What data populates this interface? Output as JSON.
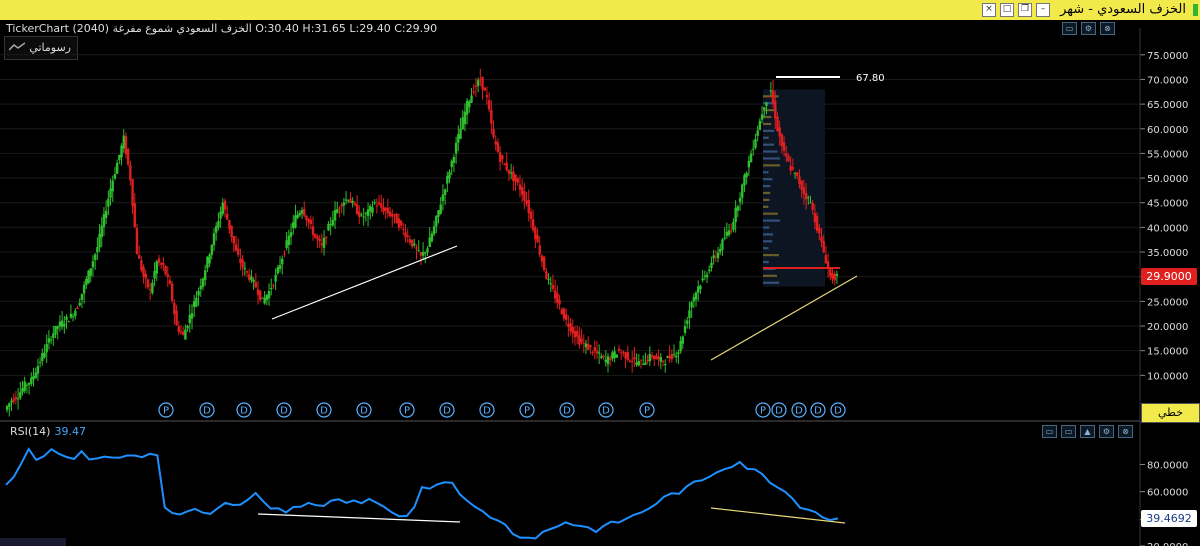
{
  "window": {
    "title": "الخزف السعودي - شهر",
    "controls": [
      "close",
      "maximize",
      "restore",
      "minimize"
    ]
  },
  "main_panel": {
    "info": "TickerChart الخزف السعودي شموع مفرغة (2040) O:30.40  H:31.65  L:29.40  C:29.90",
    "drawings_button": "رسوماتي",
    "price_ticks": [
      "75.0000",
      "70.0000",
      "65.0000",
      "60.0000",
      "55.0000",
      "50.0000",
      "45.0000",
      "40.0000",
      "35.0000",
      "30.0000",
      "25.0000",
      "20.0000",
      "15.0000",
      "10.0000"
    ],
    "last_price": "29.9000",
    "high_label": "67.80",
    "scale_mode_button": "خطي",
    "markers": [
      "P",
      "D",
      "D",
      "D",
      "D",
      "D",
      "P",
      "D",
      "D",
      "P",
      "D",
      "D",
      "P",
      "P",
      "D",
      "D",
      "D",
      "D"
    ]
  },
  "rsi_panel": {
    "label": "RSI(14)",
    "value": "39.47",
    "ticks": [
      "80.0000",
      "60.0000",
      "39.4692",
      "20.0000"
    ],
    "badge": "39.4692"
  },
  "colors": {
    "up": "#2fbf2f",
    "down": "#e01f1f",
    "rsi_line": "#1e90ff",
    "titlebar": "#f2e94a",
    "grid": "#1a1a1a"
  },
  "chart_data": {
    "type": "candlestick",
    "title": "الخزف السعودي",
    "interval": "monthly",
    "ohlc_last": {
      "open": 30.4,
      "high": 31.65,
      "low": 29.4,
      "close": 29.9
    },
    "ylim": [
      5,
      78
    ],
    "close_path": [
      3,
      5,
      6,
      8,
      9,
      12,
      15,
      18,
      20,
      21,
      22,
      24,
      28,
      32,
      36,
      42,
      48,
      53,
      58,
      50,
      35,
      30,
      27,
      33,
      32,
      28,
      20,
      18,
      22,
      26,
      30,
      35,
      40,
      45,
      40,
      35,
      32,
      30,
      28,
      25,
      27,
      30,
      34,
      38,
      42,
      44,
      41,
      38,
      36,
      40,
      43,
      45,
      46,
      44,
      42,
      43,
      45,
      44,
      43,
      42,
      40,
      38,
      36,
      34,
      36,
      40,
      45,
      50,
      55,
      60,
      65,
      68,
      70,
      66,
      58,
      54,
      52,
      50,
      48,
      45,
      40,
      35,
      30,
      27,
      24,
      21,
      19,
      17,
      16,
      15,
      14,
      13,
      14,
      15,
      14,
      13,
      12.5,
      13,
      14,
      13,
      13,
      14,
      15,
      20,
      25,
      28,
      30,
      33,
      35,
      38,
      40,
      45,
      50,
      55,
      60,
      65,
      67.8,
      60,
      55,
      52,
      50,
      47,
      45,
      40,
      35,
      30,
      29.9
    ],
    "annotations": [
      {
        "type": "horizontal",
        "value": 67.8,
        "label": "67.80"
      }
    ],
    "rsi": {
      "period": 14,
      "last": 39.47,
      "ylim": [
        20,
        98
      ],
      "values": [
        65,
        70,
        80,
        90,
        85,
        88,
        92,
        87,
        86,
        85,
        88,
        85,
        86,
        87,
        84,
        86,
        85,
        86,
        87,
        88,
        88,
        50,
        45,
        42,
        45,
        46,
        43,
        45,
        48,
        50,
        52,
        50,
        55,
        58,
        52,
        48,
        47,
        46,
        48,
        50,
        52,
        50,
        48,
        52,
        55,
        50,
        52,
        51,
        53,
        50,
        48,
        46,
        42,
        44,
        50,
        62,
        64,
        66,
        67,
        68,
        60,
        52,
        48,
        45,
        42,
        40,
        35,
        30,
        28,
        26,
        27,
        30,
        32,
        35,
        38,
        36,
        35,
        33,
        32,
        34,
        36,
        38,
        40,
        42,
        45,
        48,
        52,
        55,
        58,
        60,
        62,
        66,
        68,
        72,
        75,
        78,
        80,
        82,
        78,
        75,
        72,
        68,
        65,
        60,
        55,
        50,
        48,
        45,
        42,
        40,
        39.47
      ]
    },
    "volume_profile": true
  }
}
